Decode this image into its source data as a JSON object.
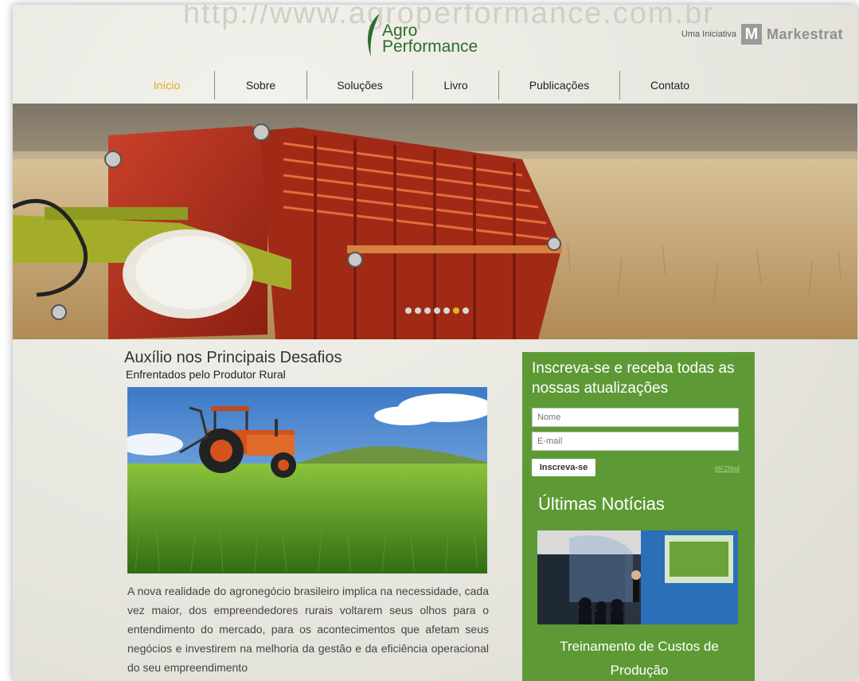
{
  "header": {
    "url_watermark": "http://www.agroperformance.com.br",
    "logo_line1": "Agro",
    "logo_line2": "Performance",
    "initiative_text": "Uma Iniciativa",
    "partner_mark": "M",
    "partner_name": "Markestrat"
  },
  "nav": {
    "items": [
      {
        "label": "Início",
        "active": true
      },
      {
        "label": "Sobre"
      },
      {
        "label": "Soluções"
      },
      {
        "label": "Livro"
      },
      {
        "label": "Publicações"
      },
      {
        "label": "Contato"
      }
    ]
  },
  "hero": {
    "slide_count": 7,
    "active_slide": 6
  },
  "main": {
    "title": "Auxílio nos Principais Desafios",
    "subtitle": "Enfrentados pelo Produtor Rural",
    "body": "A nova realidade do agronegócio brasileiro implica na necessidade, cada vez maior, dos empreendedores rurais voltarem seus olhos para o entendimento do mercado, para os acontecimentos que afetam seus negócios e investirem na melhoria da gestão e da eficiência operacional do seu empreendimento"
  },
  "sidebar": {
    "subscribe_title": "Inscreva-se e receba todas as nossas atualizações",
    "name_placeholder": "Nome",
    "email_placeholder": "E-mail",
    "subscribe_button": "Inscreva-se",
    "provider_link": "MFZMail",
    "news_heading": "Últimas Notícias",
    "news_item_title": "Treinamento de Custos de Produção"
  },
  "colors": {
    "brand_green": "#2b6e2c",
    "sidebar_green": "#5d9a35",
    "nav_active": "#e2a81c",
    "harvester_red": "#b72e1c"
  }
}
